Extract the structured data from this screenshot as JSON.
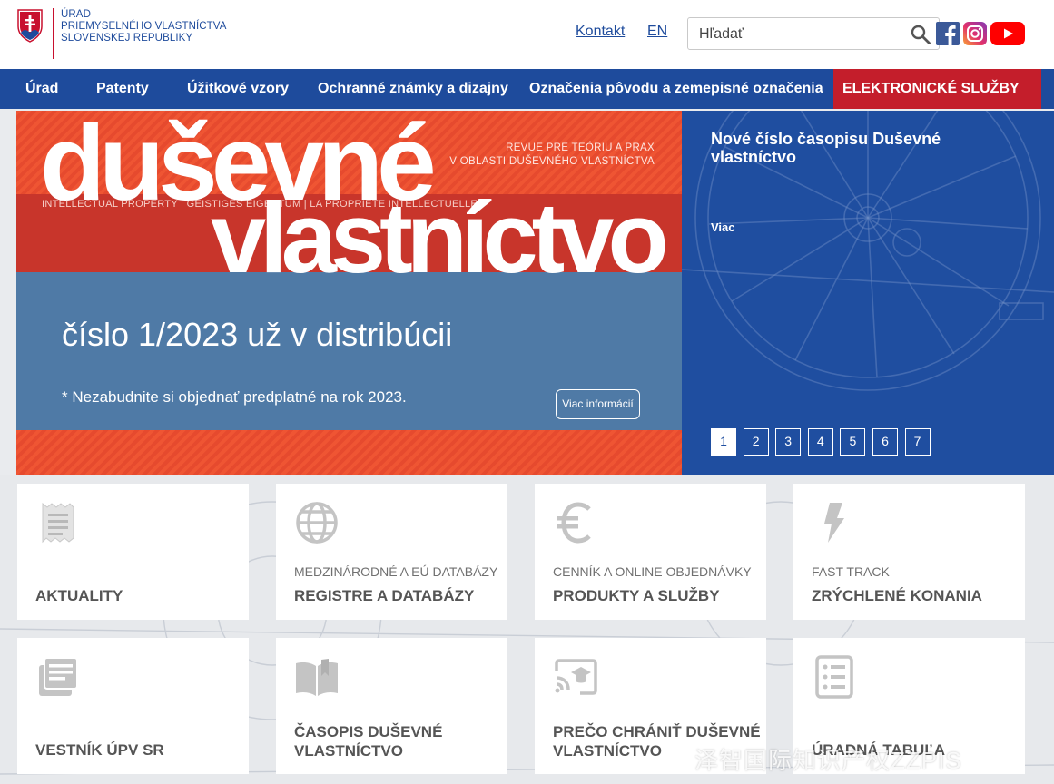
{
  "header": {
    "logo_lines": [
      "ÚRAD",
      "PRIEMYSELNÉHO VLASTNÍCTVA",
      "SLOVENSKEJ REPUBLIKY"
    ],
    "contact_label": "Kontakt",
    "language_label": "EN",
    "search_placeholder": "Hľadať",
    "colors": {
      "brand_blue": "#1e4b9c",
      "brand_red": "#c41e2b"
    }
  },
  "nav": {
    "items": [
      {
        "label": "Úrad"
      },
      {
        "label": "Patenty"
      },
      {
        "label": "Úžitkové vzory"
      },
      {
        "label": "Ochranné známky a dizajny"
      },
      {
        "label": "Označenia pôvodu a zemepisné označenia"
      },
      {
        "label": "ELEKTRONICKÉ SLUŽBY"
      }
    ]
  },
  "banner": {
    "title_line1": "duševné",
    "title_line2": "vlastníctvo",
    "revue_line1": "REVUE PRE TEÓRIU A PRAX",
    "revue_line2": "V OBLASTI DUŠEVNÉHO VLASTNÍCTVA",
    "ip_line": "INTELLECTUAL PROPERTY | GEISTIGES EIGENTUM | LA PROPRIETE INTELLECTUELLE",
    "issue_text": "číslo 1/2023 už v distribúcii",
    "note_text": "* Nezabudnite si objednať predplatné na rok 2023.",
    "more_button": "Viac informácií"
  },
  "slider": {
    "title": "Nové číslo časopisu Duševné vlastníctvo",
    "more_link": "Viac",
    "pages": [
      "1",
      "2",
      "3",
      "4",
      "5",
      "6",
      "7"
    ],
    "active_page": "1"
  },
  "tiles": [
    {
      "subtitle": "",
      "title": "AKTUALITY",
      "icon": "receipt-icon"
    },
    {
      "subtitle": "MEDZINÁRODNÉ A EÚ DATABÁZY",
      "title": "REGISTRE A DATABÁZY",
      "icon": "globe-icon"
    },
    {
      "subtitle": "CENNÍK A ONLINE OBJEDNÁVKY",
      "title": "PRODUKTY A SLUŽBY",
      "icon": "euro-icon"
    },
    {
      "subtitle": "FAST TRACK",
      "title": "ZRÝCHLENÉ KONANIA",
      "icon": "lightning-icon"
    },
    {
      "subtitle": "",
      "title": "VESTNÍK ÚPV SR",
      "icon": "newspaper-icon"
    },
    {
      "subtitle": "",
      "title_line1": "ČASOPIS DUŠEVNÉ",
      "title_line2": "VLASTNÍCTVO",
      "icon": "book-icon"
    },
    {
      "subtitle": "",
      "title_line1": "PREČO CHRÁNIŤ DUŠEVNÉ",
      "title_line2": "VLASTNÍCTVO",
      "icon": "cast-education-icon"
    },
    {
      "subtitle": "",
      "title": "ÚRADNÁ TABUĽA",
      "icon": "list-document-icon"
    }
  ],
  "watermark": "泽智国际知识产权ZZPIS"
}
